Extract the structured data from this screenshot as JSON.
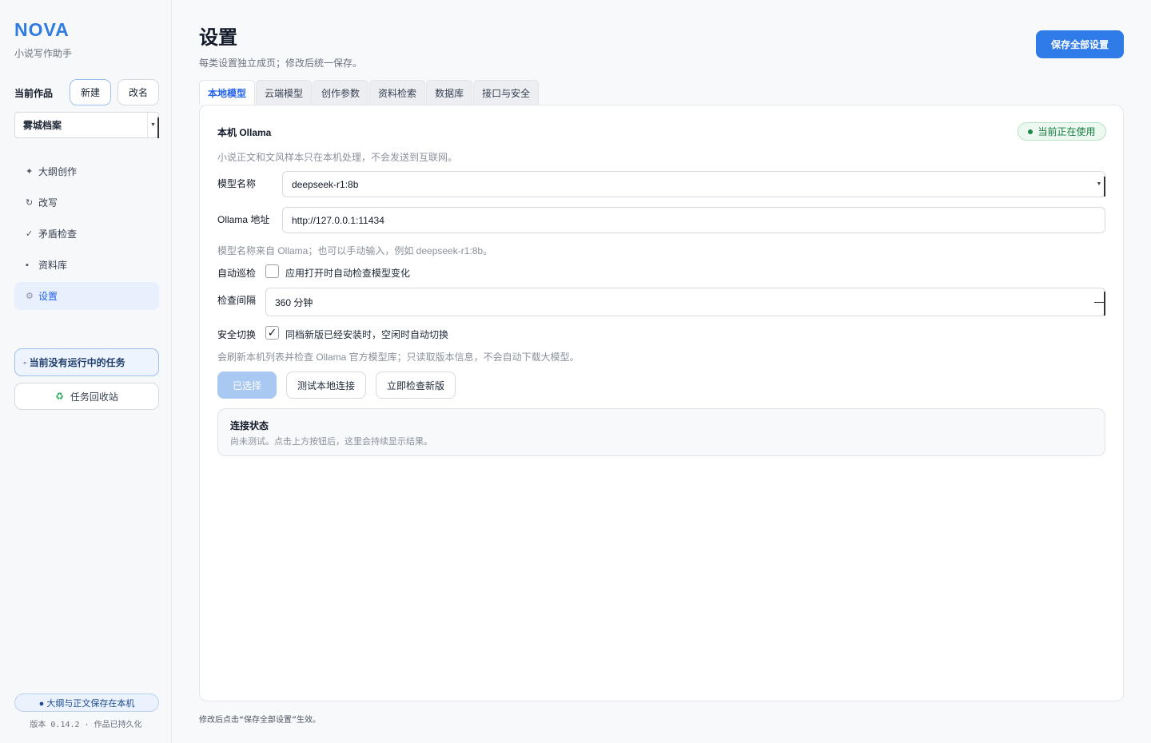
{
  "sidebar": {
    "brand": "NOVA",
    "brand_sub": "小说写作助手",
    "work_label": "当前作品",
    "new_label": "新建",
    "rename_label": "改名",
    "current_work": "雾城档案",
    "nav": [
      {
        "icon": "✦",
        "label": "大纲创作",
        "active": false
      },
      {
        "icon": "↻",
        "label": "改写",
        "active": false
      },
      {
        "icon": "✓",
        "label": "矛盾检查",
        "active": false
      },
      {
        "icon": "▪",
        "label": "资料库",
        "active": false
      },
      {
        "icon": "⚙",
        "label": "设置",
        "active": true
      }
    ],
    "task_status": "◦ 当前没有运行中的任务",
    "recycle_icon": "♻",
    "recycle_label": "任务回收站",
    "save_local": "● 大纲与正文保存在本机",
    "version": "版本 0.14.2 · 作品已持久化"
  },
  "main": {
    "title": "设置",
    "subtitle": "每类设置独立成页；修改后统一保存。",
    "save_all_label": "保存全部设置",
    "tabs": [
      {
        "label": "本地模型",
        "active": true
      },
      {
        "label": "云端模型",
        "active": false
      },
      {
        "label": "创作参数",
        "active": false
      },
      {
        "label": "资料检索",
        "active": false
      },
      {
        "label": "数据库",
        "active": false
      },
      {
        "label": "接口与安全",
        "active": false
      }
    ],
    "footer_note": "修改后点击“保存全部设置”生效。"
  },
  "panel": {
    "section_title": "本机 Ollama",
    "badge": "当前正在使用",
    "description": "小说正文和文风样本只在本机处理，不会发送到互联网。",
    "model_label": "模型名称",
    "model_value": "deepseek-r1:8b",
    "address_label": "Ollama 地址",
    "address_value": "http://127.0.0.1:11434",
    "model_hint": "模型名称来自 Ollama；也可以手动输入，例如 deepseek-r1:8b。",
    "auto_check_label": "自动巡检",
    "auto_check_text": "应用打开时自动检查模型变化",
    "auto_check_checked": false,
    "interval_label": "检查间隔",
    "interval_value": "360 分钟",
    "safe_switch_label": "安全切换",
    "safe_switch_text": "同档新版已经安装时，空闲时自动切换",
    "safe_switch_checked": true,
    "safe_switch_mark": "✓",
    "refresh_hint": "会刷新本机列表并检查 Ollama 官方模型库；只读取版本信息，不会自动下载大模型。",
    "btn_selected": "已选择",
    "btn_test": "测试本地连接",
    "btn_check": "立即检查新版",
    "status_title": "连接状态",
    "status_text": "尚未测试。点击上方按钮后，这里会持续显示结果。"
  },
  "colors": {
    "accent": "#2f7be8",
    "success": "#157a3e"
  }
}
